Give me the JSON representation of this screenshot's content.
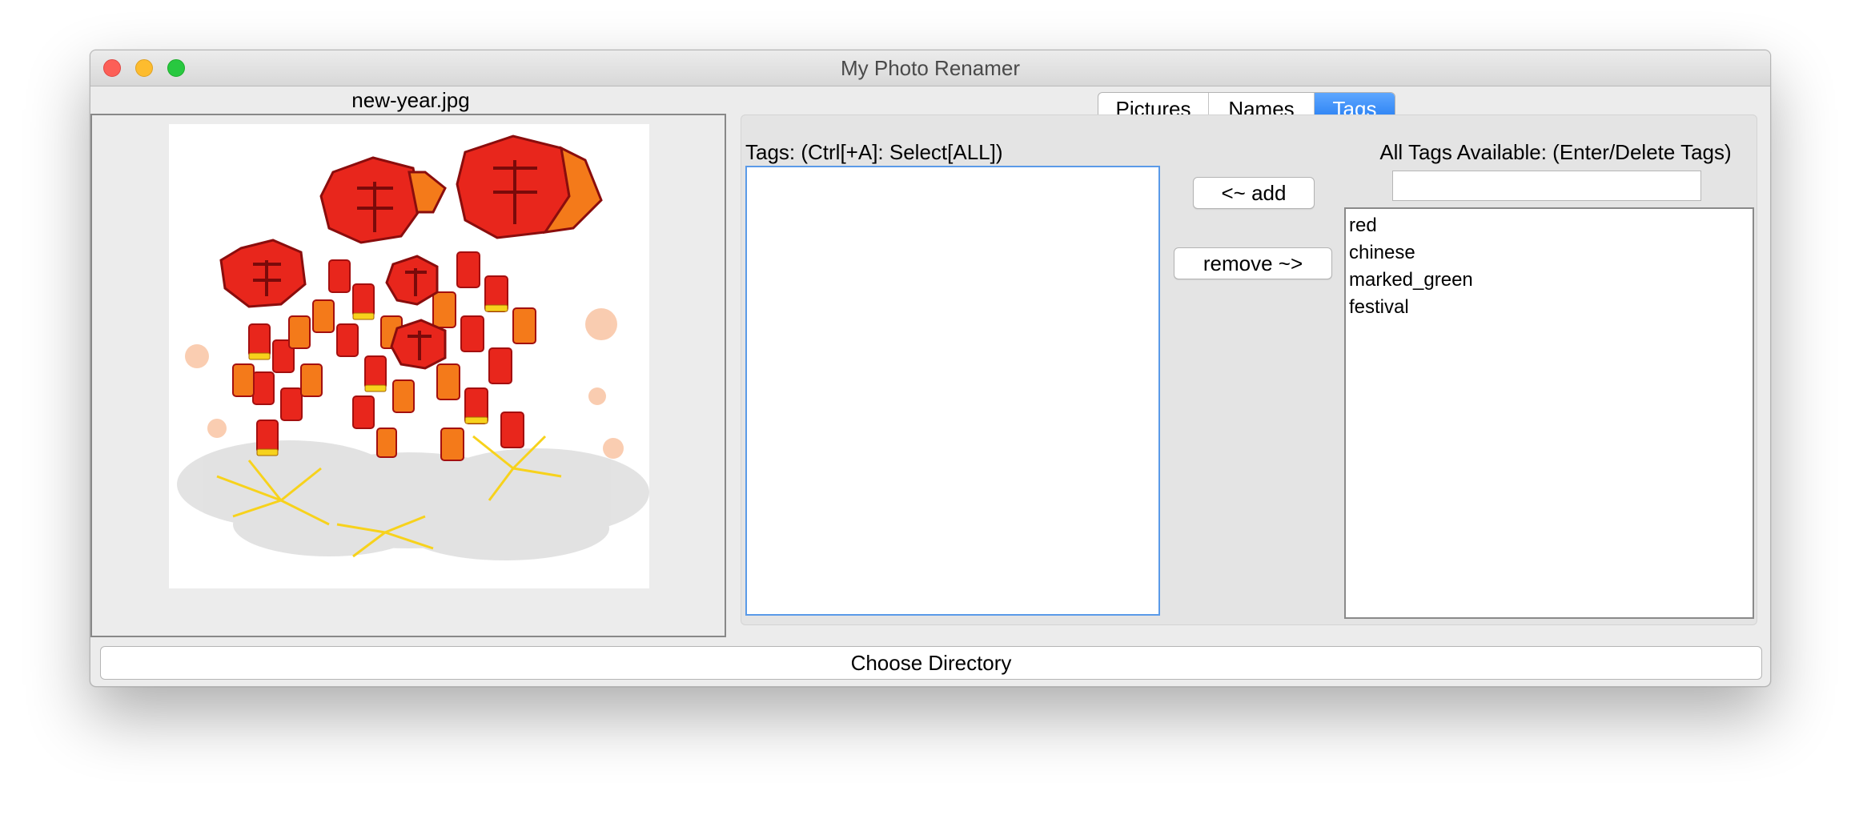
{
  "window": {
    "title": "My Photo Renamer"
  },
  "preview": {
    "filename": "new-year.jpg"
  },
  "tabs": [
    {
      "label": "Pictures",
      "active": false
    },
    {
      "label": "Names",
      "active": false
    },
    {
      "label": "Tags",
      "active": true
    }
  ],
  "tags_panel": {
    "tags_label": "Tags: (Ctrl[+A]: Select[ALL])",
    "add_label": "<~ add",
    "remove_label": "remove ~>",
    "available_label": "All Tags Available: (Enter/Delete Tags)",
    "tag_input_value": "",
    "available_tags": [
      "red",
      "chinese",
      "marked_green",
      "festival"
    ]
  },
  "footer": {
    "choose_directory_label": "Choose Directory"
  },
  "colors": {
    "accent": "#1e78f0",
    "focus_border": "#5a9ae8",
    "firecracker_red": "#e8261c",
    "firecracker_orange": "#f47a1a",
    "gold": "#f7d21c"
  },
  "icons": [
    "close-window-icon",
    "minimize-window-icon",
    "maximize-window-icon"
  ]
}
